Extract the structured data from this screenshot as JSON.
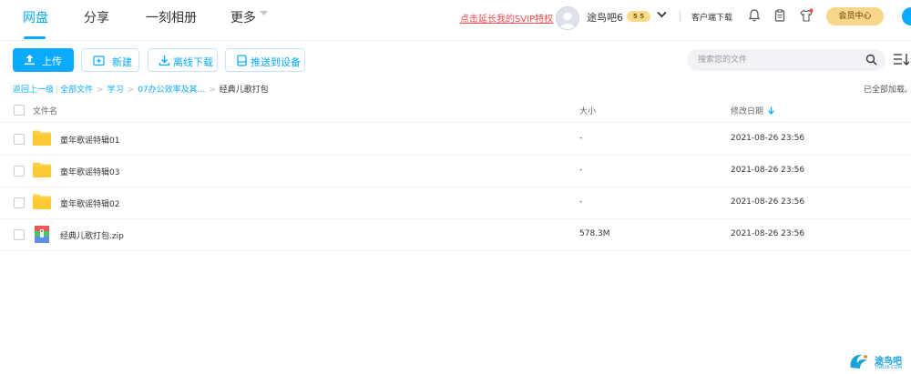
{
  "nav": {
    "tabs": [
      {
        "label": "网盘",
        "active": true
      },
      {
        "label": "分享",
        "active": false
      },
      {
        "label": "一刻相册",
        "active": false
      },
      {
        "label": "更多",
        "active": false
      }
    ],
    "promo": "点击延长我的SVIP特权",
    "username": "途鸟吧6",
    "level_badge": "5 5",
    "client_download": "客户端下载",
    "member_center": "会员中心"
  },
  "toolbar": {
    "upload": "上传",
    "new": "新建",
    "offline_download": "离线下载",
    "push_device": "推送到设备",
    "search_placeholder": "搜索您的文件"
  },
  "breadcrumb": {
    "back": "返回上一级",
    "all_files": "全部文件",
    "path": [
      "学习",
      "07办公效率及其...",
      "经典儿歌打包"
    ],
    "status": "已全部加载,"
  },
  "table": {
    "headers": {
      "name": "文件名",
      "size": "大小",
      "modified": "修改日期"
    },
    "rows": [
      {
        "name": "童年歌谣特辑01",
        "size": "-",
        "date": "2021-08-26 23:56",
        "type": "folder"
      },
      {
        "name": "童年歌谣特辑03",
        "size": "-",
        "date": "2021-08-26 23:56",
        "type": "folder"
      },
      {
        "name": "童年歌谣特辑02",
        "size": "-",
        "date": "2021-08-26 23:56",
        "type": "folder"
      },
      {
        "name": "经典儿歌打包.zip",
        "size": "578.3M",
        "date": "2021-08-26 23:56",
        "type": "zip"
      }
    ]
  },
  "watermark": {
    "text": "途鸟吧",
    "sub": "TNB26.COM"
  },
  "icons": {
    "upload": "upload-icon",
    "new": "new-folder-icon",
    "offline": "download-icon",
    "push": "device-icon",
    "search": "search-icon",
    "list": "list-view-icon",
    "bell": "bell-icon",
    "clipboard": "clipboard-icon",
    "shirt": "shirt-icon",
    "folder": "folder-icon",
    "zip": "zip-file-icon"
  },
  "colors": {
    "accent": "#09aaff",
    "promo": "#f94a4a",
    "member": "#f7d68a",
    "folder": "#ffd04b"
  }
}
